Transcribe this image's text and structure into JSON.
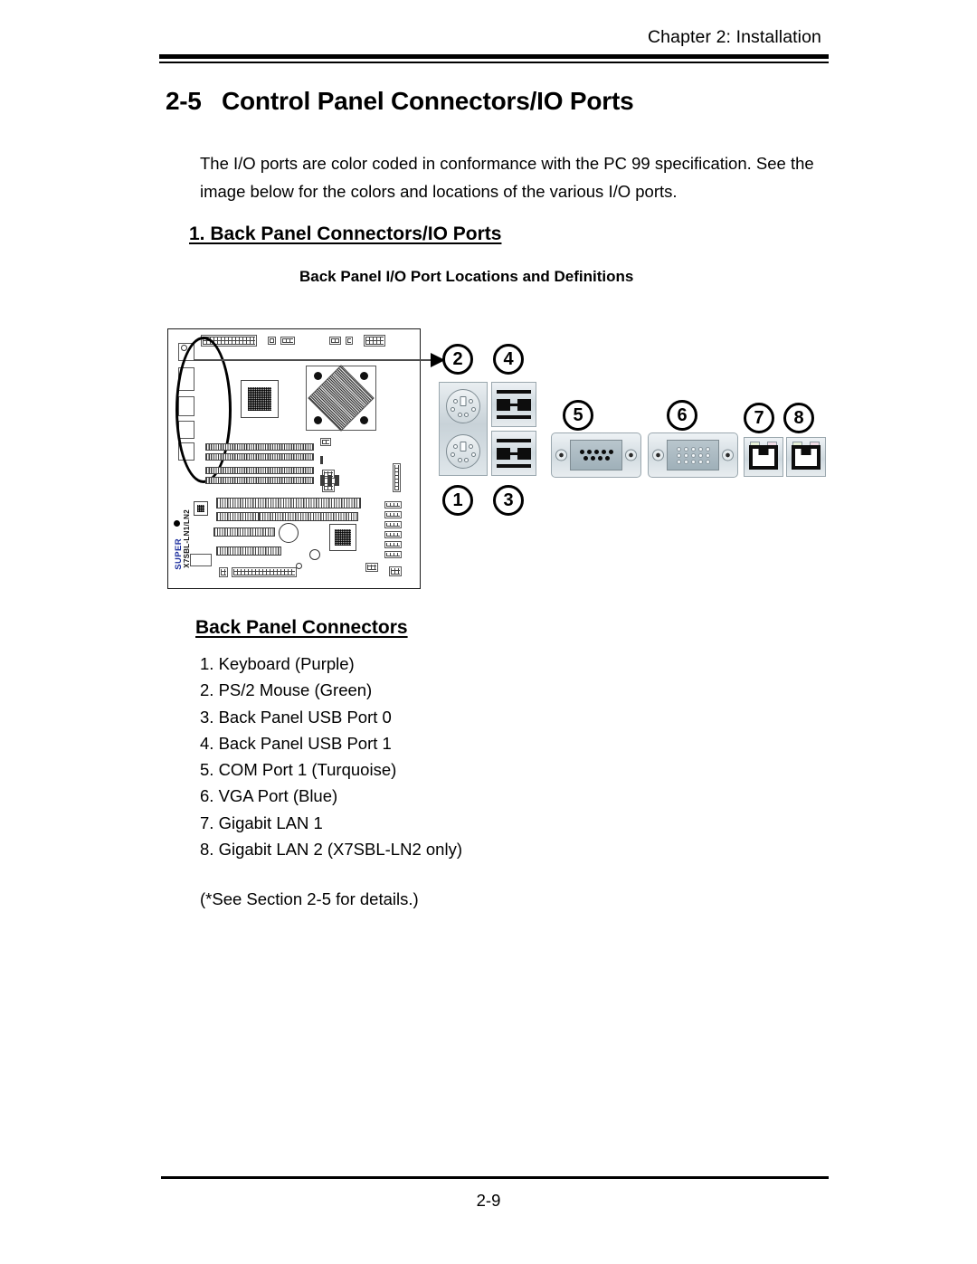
{
  "header": {
    "chapter": "Chapter 2: Installation"
  },
  "section": {
    "number": "2-5",
    "title": "Control Panel Connectors/IO Ports"
  },
  "intro": {
    "paragraph": "The I/O ports are color coded in conformance with the PC 99 specification. See the image below for the colors and locations of the various I/O ports."
  },
  "subsection": {
    "heading": "1. Back Panel Connectors/IO Ports"
  },
  "figure": {
    "caption": "Back Panel I/O Port Locations and Definitions",
    "board": {
      "brand": "SUPER",
      "model": "X7SBL-LN1/LN2"
    },
    "callouts": [
      {
        "id": "2",
        "label": "2"
      },
      {
        "id": "4",
        "label": "4"
      },
      {
        "id": "5",
        "label": "5"
      },
      {
        "id": "6",
        "label": "6"
      },
      {
        "id": "7",
        "label": "7"
      },
      {
        "id": "8",
        "label": "8"
      },
      {
        "id": "1",
        "label": "1"
      },
      {
        "id": "3",
        "label": "3"
      }
    ]
  },
  "connectors": {
    "heading": "Back Panel Connectors",
    "items": [
      "1. Keyboard (Purple)",
      "2. PS/2 Mouse (Green)",
      "3. Back Panel USB Port 0",
      "4. Back Panel USB Port 1",
      "5. COM Port 1 (Turquoise)",
      "6. VGA Port (Blue)",
      "7. Gigabit LAN 1",
      "8. Gigabit LAN 2 (X7SBL-LN2 only)"
    ],
    "note": "(*See Section 2-5 for details.)"
  },
  "footer": {
    "page": "2-9"
  }
}
